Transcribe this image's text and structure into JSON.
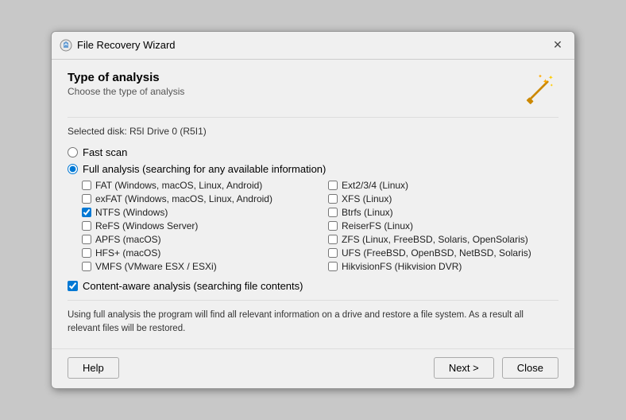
{
  "dialog": {
    "title": "File Recovery Wizard",
    "close_label": "✕"
  },
  "header": {
    "title": "Type of analysis",
    "subtitle": "Choose the type of analysis"
  },
  "selected_disk": {
    "label": "Selected disk: R5I Drive 0 (R5I1)"
  },
  "analysis_options": {
    "fast_scan_label": "Fast scan",
    "full_analysis_label": "Full analysis (searching for any available information)"
  },
  "filesystem_options_left": [
    {
      "id": "fat",
      "label": "FAT (Windows, macOS, Linux, Android)",
      "checked": false
    },
    {
      "id": "exfat",
      "label": "exFAT (Windows, macOS, Linux, Android)",
      "checked": false
    },
    {
      "id": "ntfs",
      "label": "NTFS (Windows)",
      "checked": true
    },
    {
      "id": "refs",
      "label": "ReFS (Windows Server)",
      "checked": false
    },
    {
      "id": "apfs",
      "label": "APFS (macOS)",
      "checked": false
    },
    {
      "id": "hfsplus",
      "label": "HFS+ (macOS)",
      "checked": false
    },
    {
      "id": "vmfs",
      "label": "VMFS (VMware ESX / ESXi)",
      "checked": false
    }
  ],
  "filesystem_options_right": [
    {
      "id": "ext234",
      "label": "Ext2/3/4 (Linux)",
      "checked": false
    },
    {
      "id": "xfs",
      "label": "XFS (Linux)",
      "checked": false
    },
    {
      "id": "btrfs",
      "label": "Btrfs (Linux)",
      "checked": false
    },
    {
      "id": "reiserfs",
      "label": "ReiserFS (Linux)",
      "checked": false
    },
    {
      "id": "zfs",
      "label": "ZFS (Linux, FreeBSD, Solaris, OpenSolaris)",
      "checked": false
    },
    {
      "id": "ufs",
      "label": "UFS (FreeBSD, OpenBSD, NetBSD, Solaris)",
      "checked": false
    },
    {
      "id": "hikvision",
      "label": "HikvisionFS (Hikvision DVR)",
      "checked": false
    }
  ],
  "content_aware": {
    "label": "Content-aware analysis (searching file contents)",
    "checked": true
  },
  "description": {
    "text": "Using full analysis the program will find all relevant information on a drive and restore a file system. As a result all relevant files will be restored."
  },
  "footer": {
    "help_label": "Help",
    "next_label": "Next >",
    "close_label": "Close"
  }
}
